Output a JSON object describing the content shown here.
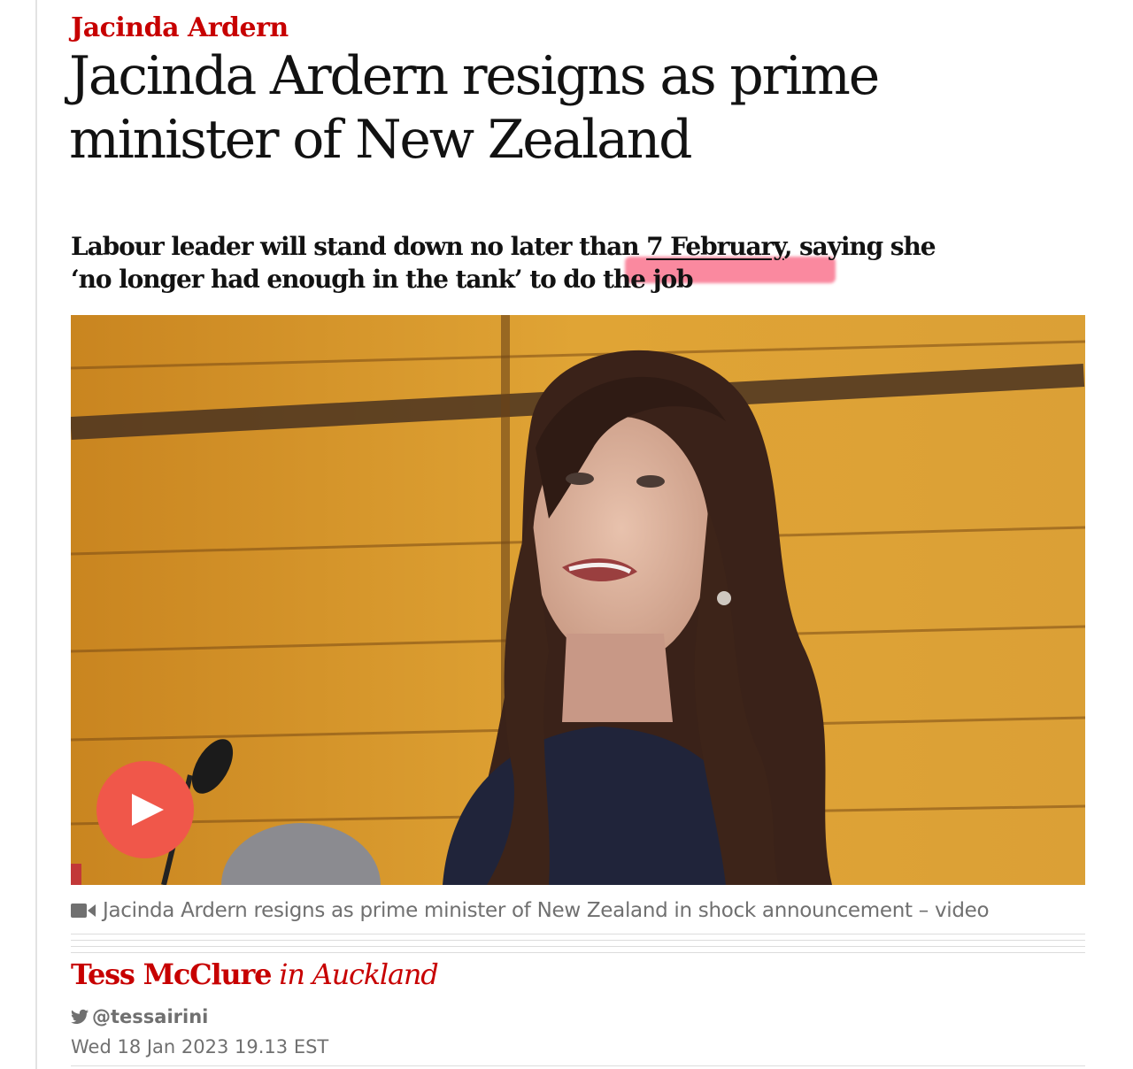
{
  "article": {
    "kicker": "Jacinda Ardern",
    "headline": "Jacinda Ardern resigns as prime minister of New Zealand",
    "standfirst": {
      "before": "Labour leader will stand down no later than ",
      "link": "7 February",
      "after_line1": ", saying she",
      "line2": "‘no longer had enough in the tank’ to do the job"
    },
    "media": {
      "play_icon": "play-icon",
      "caption_icon": "video-camera-icon",
      "caption": "Jacinda Ardern resigns as prime minister of New Zealand in shock announcement – video"
    },
    "byline": {
      "author": "Tess McClure",
      "location": "in Auckland",
      "twitter_icon": "twitter-bird-icon",
      "twitter": "@tessairini",
      "date": "Wed 18 Jan 2023 19.13 EST"
    }
  },
  "colors": {
    "kicker": "#c70000",
    "text": "#121212",
    "meta": "#707070",
    "play_button": "#f0574a",
    "highlight": "#f52850"
  }
}
